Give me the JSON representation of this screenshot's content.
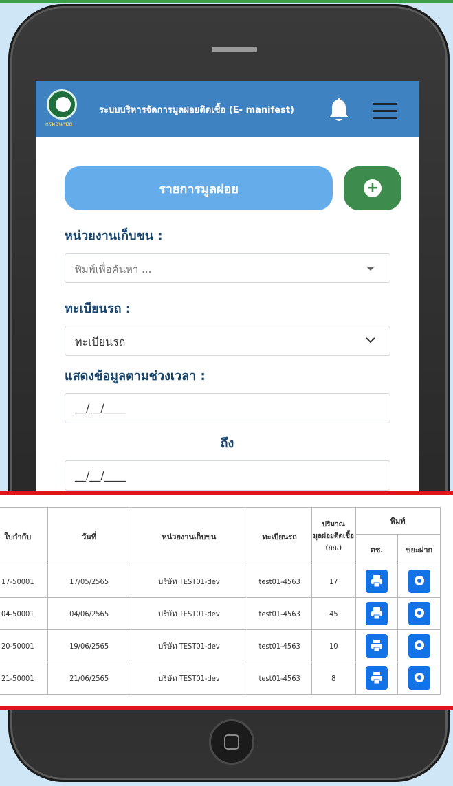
{
  "app": {
    "title": "ระบบบริหารจัดการมูลฝอยติดเชื้อ (E- manifest)",
    "logo_text": "กรมอนามัย"
  },
  "toolbar": {
    "list_label": "รายการมูลฝอย",
    "add_label": "+"
  },
  "form": {
    "collector_label": "หน่วยงานเก็บขน :",
    "collector_placeholder": "พิมพ์เพื่อค้นหา ...",
    "plate_label": "ทะเบียนรถ :",
    "plate_value": "ทะเบียนรถ",
    "range_label": "แสดงข้อมูลตามช่วงเวลา :",
    "date_from": "__/__/____",
    "to_label": "ถึง",
    "date_to": "__/__/____"
  },
  "table": {
    "headers": {
      "doc_no": "ใบกำกับ",
      "date": "วันที่",
      "collector": "หน่วยงานเก็บขน",
      "plate": "ทะเบียนรถ",
      "quantity": "ปริมาณ มูลฝอยติดเชื้อ (กก.)",
      "print": "พิมพ์",
      "print_doc": "ตช.",
      "print_dispose": "ขยะฝาก"
    },
    "rows": [
      {
        "doc_no": "17-50001",
        "date": "17/05/2565",
        "collector": "บริษัท TEST01-dev",
        "plate": "test01-4563",
        "qty": "17"
      },
      {
        "doc_no": "04-50001",
        "date": "04/06/2565",
        "collector": "บริษัท TEST01-dev",
        "plate": "test01-4563",
        "qty": "45"
      },
      {
        "doc_no": "20-50001",
        "date": "19/06/2565",
        "collector": "บริษัท TEST01-dev",
        "plate": "test01-4563",
        "qty": "10"
      },
      {
        "doc_no": "21-50001",
        "date": "21/06/2565",
        "collector": "บริษัท TEST01-dev",
        "plate": "test01-4563",
        "qty": "8"
      }
    ]
  },
  "colors": {
    "header_bg": "#3f82c1",
    "list_button": "#64acea",
    "add_button": "#3d8c4d",
    "label_text": "#17456e",
    "print_button": "#1272e6",
    "highlight_border": "#e2141b"
  }
}
